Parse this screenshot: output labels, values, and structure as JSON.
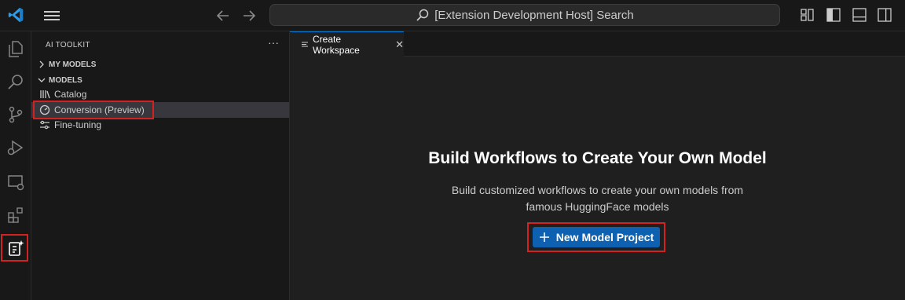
{
  "titlebar": {
    "search_text": "[Extension Development Host] Search",
    "icons": [
      "vscode-logo-icon",
      "menu-icon",
      "arrow-left-icon",
      "arrow-right-icon",
      "search-icon",
      "customize-layout-icon",
      "toggle-primary-sidebar-icon",
      "toggle-panel-icon",
      "toggle-secondary-sidebar-icon"
    ]
  },
  "activitybar": {
    "items": [
      "explorer-icon",
      "search-icon",
      "source-control-icon",
      "run-debug-icon",
      "remote-explorer-icon",
      "extensions-icon",
      "ai-toolkit-icon"
    ]
  },
  "sidebar": {
    "title": "AI TOOLKIT",
    "more": "···",
    "sections": [
      {
        "label": "MY MODELS"
      },
      {
        "label": "MODELS"
      }
    ],
    "items": [
      {
        "label": "Catalog",
        "icon": "library-icon"
      },
      {
        "label": "Conversion (Preview)",
        "icon": "gauge-icon"
      },
      {
        "label": "Fine-tuning",
        "icon": "settings-sliders-icon"
      }
    ]
  },
  "editor": {
    "tab": {
      "label": "Create Workspace",
      "close": "✕"
    },
    "heading": "Build Workflows to Create Your Own Model",
    "description_line1": "Build customized workflows to create your own models from",
    "description_line2": "famous HuggingFace models",
    "cta_label": "New Model Project"
  },
  "colors": {
    "accent": "#0e61b0",
    "highlight": "#d32222",
    "background": "#1f1f1f",
    "chrome": "#181818"
  }
}
